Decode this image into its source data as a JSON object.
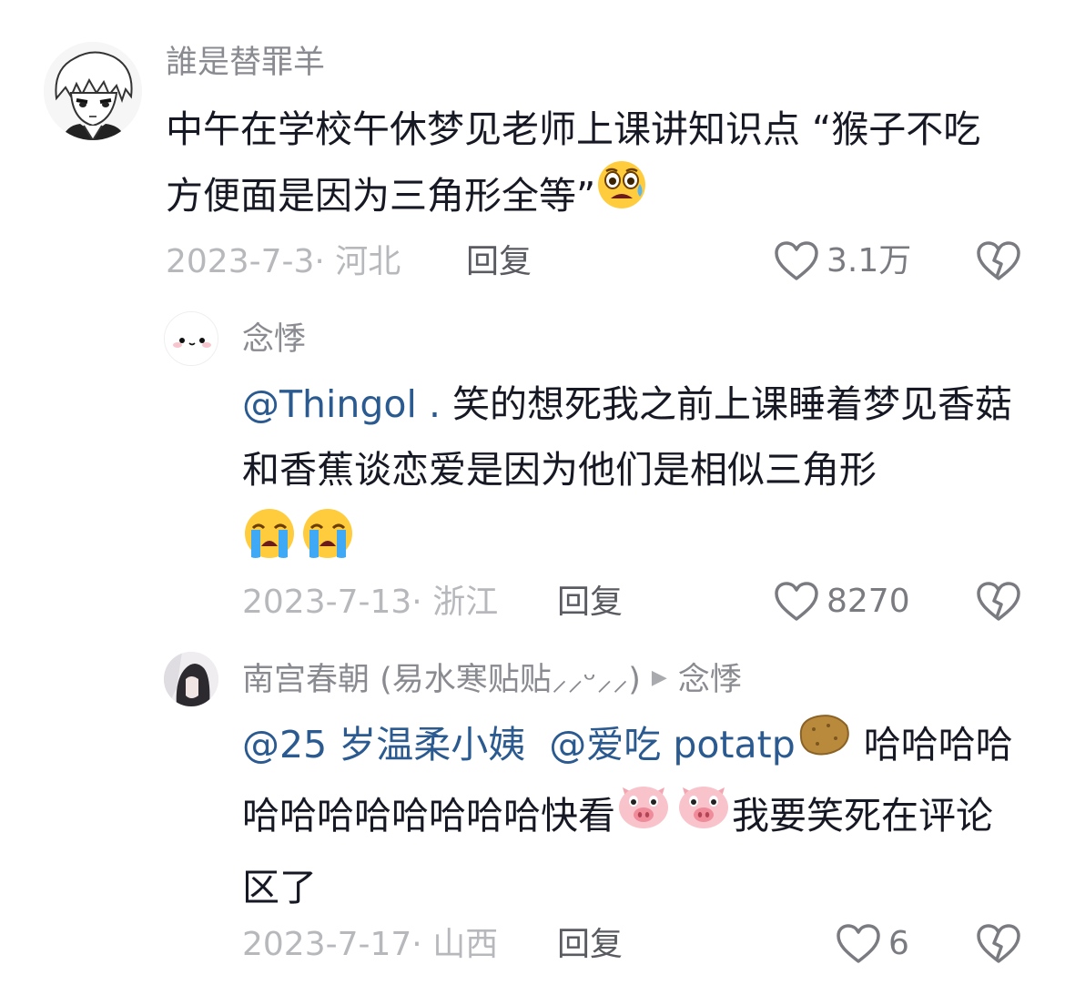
{
  "comments": [
    {
      "username": "誰是替罪羊",
      "text": "中午在学校午休梦见老师上课讲知识点 “猴子不吃方便面是因为三角形全等”",
      "date_location": "2023-7-3· 河北",
      "reply_label": "回复",
      "likes": "3.1万",
      "avatar_icon": "anime-boy-avatar",
      "trailing_emoji": "scared-sweat-emoji"
    },
    {
      "username": "念悸",
      "mention": "@Thingol .",
      "text": " 笑的想死我之前上课睡着梦见香菇和香蕉谈恋爱是因为他们是相似三角形",
      "date_location": "2023-7-13· 浙江",
      "reply_label": "回复",
      "likes": "8270",
      "avatar_icon": "cute-face-avatar",
      "trailing_emoji": "loudly-crying-emoji"
    },
    {
      "username": "南宫春朝 (易水寒贴贴⸝⸝ᵕ⸝⸝)",
      "reply_to": "念悸",
      "mention1": "@25 岁温柔小姨",
      "mention2": "@爱吃 potatp",
      "text": " 哈哈哈哈哈哈哈哈哈哈哈哈快看",
      "text2": "我要笑死在评论区了",
      "date_location": "2023-7-17· 山西",
      "reply_label": "回复",
      "likes": "6",
      "avatar_icon": "girl-photo-avatar",
      "emojis": [
        "potato-emoji",
        "pig-face-emoji"
      ]
    }
  ],
  "colors": {
    "username": "#8a8b91",
    "text": "#161823",
    "mention": "#2a5a8f",
    "meta": "#b7b8bc",
    "reply": "#5a5b61"
  }
}
